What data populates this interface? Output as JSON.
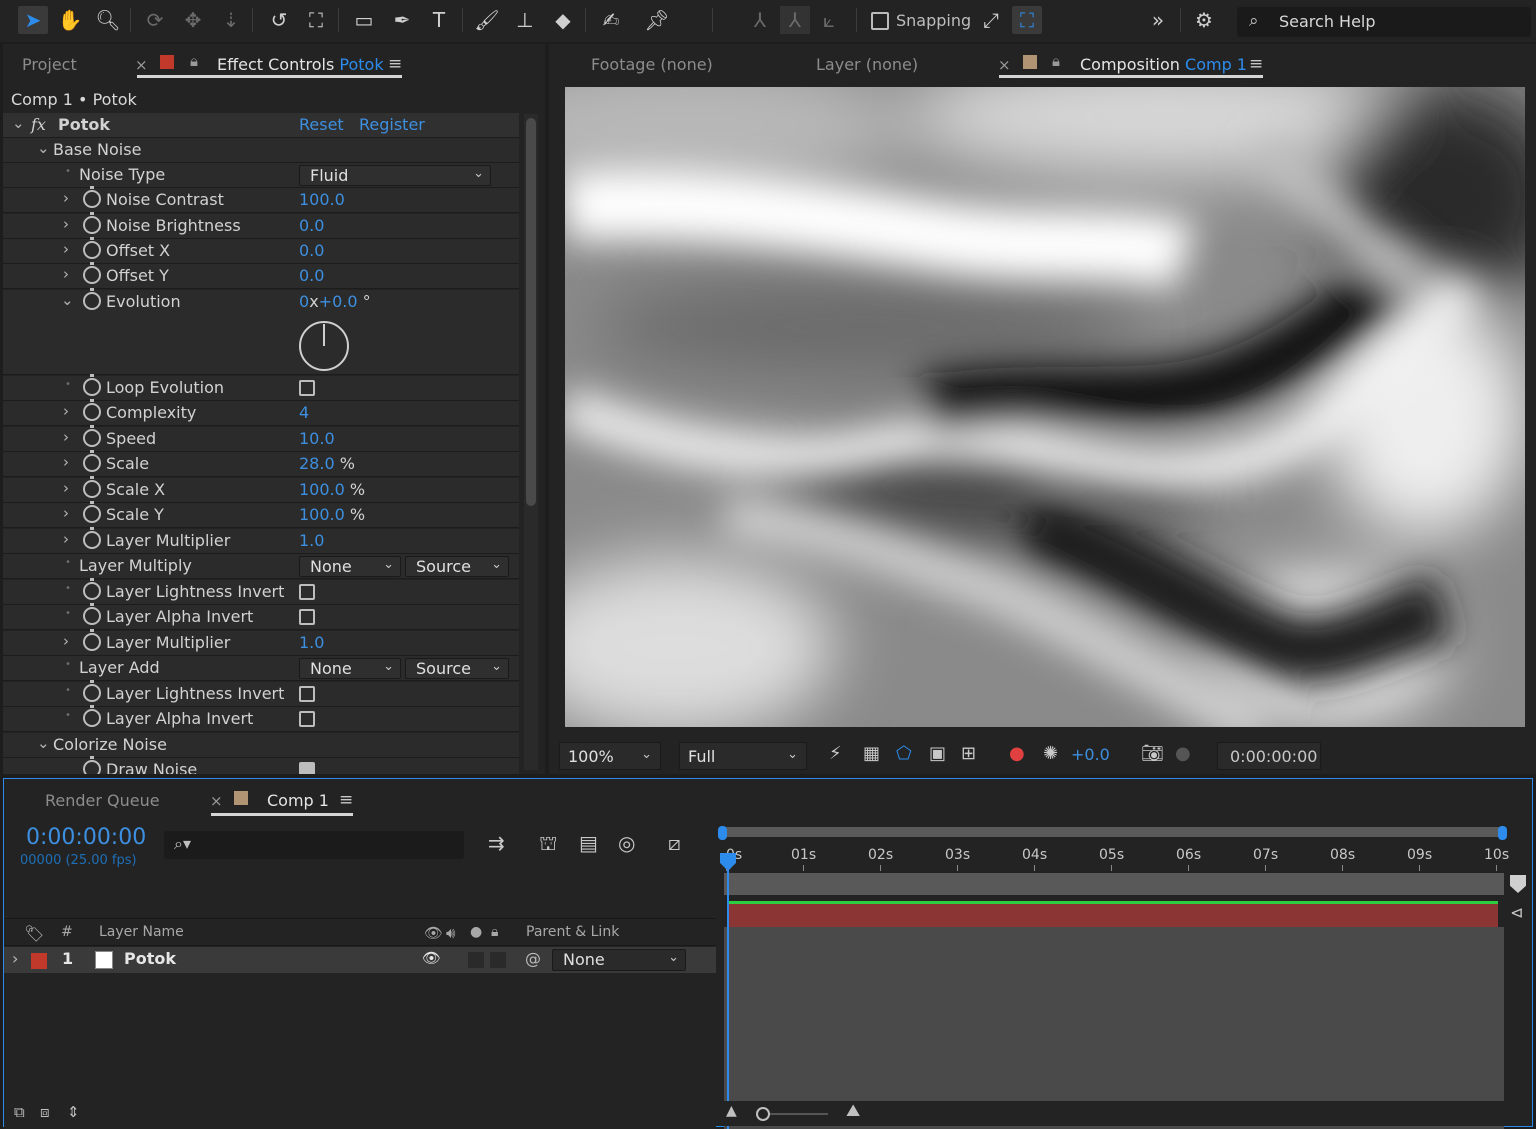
{
  "toolbar": {
    "snapping_label": "Snapping",
    "search_help_label": "Search Help"
  },
  "effect_panel": {
    "tabs": {
      "project": "Project",
      "effect_controls": "Effect Controls",
      "effect_controls_target": "Potok"
    },
    "path": "Comp 1 • Potok",
    "effect_name": "Potok",
    "reset_label": "Reset",
    "register_label": "Register",
    "base_noise_label": "Base Noise",
    "colorize_noise_label": "Colorize Noise",
    "draw_noise_label": "Draw Noise",
    "noise_type": {
      "label": "Noise Type",
      "value": "Fluid"
    },
    "noise_contrast": {
      "label": "Noise Contrast",
      "value": "100.0"
    },
    "noise_brightness": {
      "label": "Noise Brightness",
      "value": "0.0"
    },
    "offset_x": {
      "label": "Offset X",
      "value": "0.0"
    },
    "offset_y": {
      "label": "Offset Y",
      "value": "0.0"
    },
    "evolution": {
      "label": "Evolution",
      "revolutions": "0",
      "x": "x",
      "degrees": "+0.0",
      "unit": "°"
    },
    "loop_evolution": {
      "label": "Loop Evolution"
    },
    "complexity": {
      "label": "Complexity",
      "value": "4"
    },
    "speed": {
      "label": "Speed",
      "value": "10.0"
    },
    "scale": {
      "label": "Scale",
      "value": "28.0",
      "unit": "%"
    },
    "scale_x": {
      "label": "Scale X",
      "value": "100.0",
      "unit": "%"
    },
    "scale_y": {
      "label": "Scale Y",
      "value": "100.0",
      "unit": "%"
    },
    "layer_multiplier_1": {
      "label": "Layer Multiplier",
      "value": "1.0"
    },
    "layer_multiply": {
      "label": "Layer Multiply",
      "layer": "None",
      "source": "Source"
    },
    "lightness_invert_1": {
      "label": "Layer Lightness Invert"
    },
    "alpha_invert_1": {
      "label": "Layer Alpha Invert"
    },
    "layer_multiplier_2": {
      "label": "Layer Multiplier",
      "value": "1.0"
    },
    "layer_add": {
      "label": "Layer Add",
      "layer": "None",
      "source": "Source"
    },
    "lightness_invert_2": {
      "label": "Layer Lightness Invert"
    },
    "alpha_invert_2": {
      "label": "Layer Alpha Invert"
    }
  },
  "comp_panel": {
    "tabs": {
      "footage": "Footage",
      "footage_value": "(none)",
      "layer": "Layer",
      "layer_value": "(none)",
      "composition": "Composition",
      "composition_value": "Comp 1"
    },
    "zoom": "100%",
    "resolution": "Full",
    "exposure": "+0.0",
    "timecode": "0:00:00:00"
  },
  "timeline": {
    "tabs": {
      "render_queue": "Render Queue",
      "comp": "Comp 1"
    },
    "timecode": "0:00:00:00",
    "frames_info": "00000 (25.00 fps)",
    "columns": {
      "hash": "#",
      "layer_name": "Layer Name",
      "parent_link": "Parent & Link"
    },
    "layer": {
      "index": "1",
      "name": "Potok",
      "parent": "None"
    },
    "ruler": [
      "0s",
      "01s",
      "02s",
      "03s",
      "04s",
      "05s",
      "06s",
      "07s",
      "08s",
      "09s",
      "10s"
    ]
  },
  "colors": {
    "accent": "#2d8ceb",
    "label_red": "#c0392b",
    "comp_swatch": "#b09473",
    "layer_bar": "#8b3535"
  }
}
